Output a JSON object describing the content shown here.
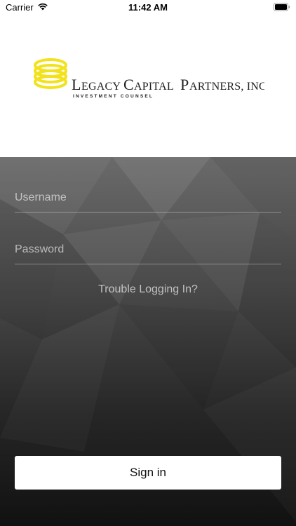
{
  "status_bar": {
    "carrier": "Carrier",
    "time": "11:42 AM",
    "wifi_icon": "wifi-icon",
    "battery_icon": "battery-icon"
  },
  "logo": {
    "name": "Legacy Capital Partners, Inc.",
    "wordmark": "Legacy Capital Partners, Inc.",
    "tagline": "Investment Counsel",
    "brand_color": "#f2e21c"
  },
  "login": {
    "username_placeholder": "Username",
    "username_value": "",
    "password_placeholder": "Password",
    "password_value": "",
    "trouble_label": "Trouble Logging In?",
    "signin_label": "Sign in"
  }
}
